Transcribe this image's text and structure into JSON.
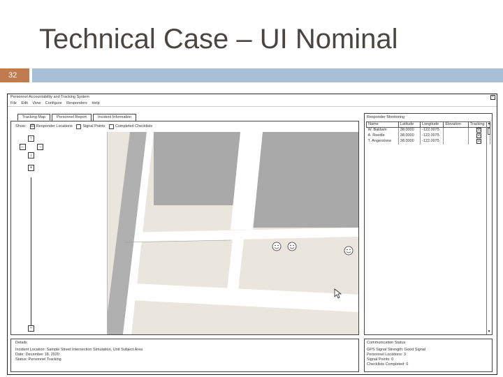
{
  "slide": {
    "title": "Technical Case – UI Nominal",
    "number": "32",
    "colors": {
      "number_box": "#c07b4e",
      "bar": "#a7bfd4",
      "title": "#4a4540"
    }
  },
  "window": {
    "title": "Personnel Accountability and Tracking System",
    "close_glyph": "×",
    "menu": [
      "File",
      "Edit",
      "View",
      "Configure",
      "Responders",
      "Help"
    ]
  },
  "tabs": [
    {
      "label": "Tracking Map",
      "active": true
    },
    {
      "label": "Personnel Report",
      "active": false
    },
    {
      "label": "Incident Information",
      "active": false
    }
  ],
  "map_panel": {
    "show_label": "Show:",
    "layers": [
      {
        "label": "Responder Locations",
        "checked": true,
        "glyph": "☑"
      },
      {
        "label": "Signal Points",
        "checked": false,
        "glyph": ""
      },
      {
        "label": "Completed Checklists",
        "checked": false,
        "glyph": ""
      }
    ],
    "zoom": {
      "up": "↑",
      "left": "←",
      "right": "→",
      "down": "↓",
      "plus": "+",
      "minus": "−"
    },
    "icons": {
      "responder": "smiley-icon",
      "cursor": "mouse-cursor-icon"
    },
    "colors": {
      "ground": "#ebe6dd",
      "building": "#a9a9a9",
      "road": "#ffffff",
      "river": "#b0b0b0"
    }
  },
  "responder_status": {
    "title": "Responder Monitoring",
    "columns": [
      "Name",
      "Latitude",
      "Longitude",
      "Elevation",
      "Tracking"
    ],
    "rows": [
      {
        "name": "W. Baldwin",
        "latitude": "38.0000",
        "longitude": "-122.0075",
        "elevation": "",
        "tracking": "☑"
      },
      {
        "name": "A. Reedle",
        "latitude": "38.0000",
        "longitude": "-122.0075",
        "elevation": "",
        "tracking": "☑"
      },
      {
        "name": "T. Angerstone",
        "latitude": "38.0000",
        "longitude": "-122.0075",
        "elevation": "",
        "tracking": "☑"
      }
    ],
    "scroll_up": "▲",
    "scroll_down": "▼"
  },
  "details": {
    "title": "Details",
    "lines": [
      "Incident Location: Sample Street Intersection Simulation, Unit Subject Area",
      "Date: December 18, 2020",
      "Status: Personnel Tracking"
    ]
  },
  "comm": {
    "title": "Communication Status",
    "lines": [
      "GPS Signal Strength: Good Signal",
      "Personnel Locations: 3",
      "Signal Points: 0",
      "Checklists Completed: 0"
    ]
  }
}
